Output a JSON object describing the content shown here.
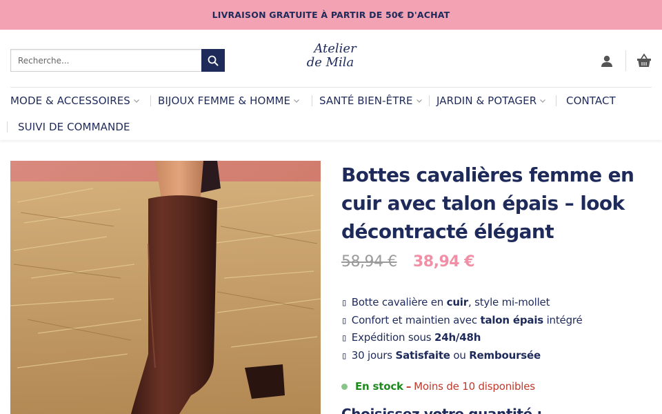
{
  "announcement": {
    "text": "LIVRAISON GRATUITE À PARTIR DE 50€ D'ACHAT"
  },
  "header": {
    "search": {
      "placeholder": "Recherche...",
      "value": ""
    },
    "logo": {
      "line1": "Atelier",
      "line2": "de Mila"
    },
    "icons": {
      "search": "search-icon",
      "account": "user-icon",
      "cart": "basket-icon"
    }
  },
  "nav": {
    "items": [
      {
        "label": "MODE & ACCESSOIRES",
        "has_dropdown": true
      },
      {
        "label": "BIJOUX FEMME & HOMME",
        "has_dropdown": true
      },
      {
        "label": "SANTÉ BIEN-ÊTRE",
        "has_dropdown": true
      },
      {
        "label": "JARDIN & POTAGER",
        "has_dropdown": true
      },
      {
        "label": "CONTACT",
        "has_dropdown": false
      },
      {
        "label": "SUIVI DE COMMANDE",
        "has_dropdown": false
      }
    ]
  },
  "product": {
    "title": "Bottes cavalières femme en cuir avec talon épais – look décontracté élégant",
    "price_old": "58,94 €",
    "price_new": "38,94 €",
    "features": [
      {
        "icon": "▯",
        "before": " Botte cavalière en ",
        "bold": "cuir",
        "after": ", style mi-mollet",
        "bold2": "",
        "after2": ""
      },
      {
        "icon": "▯",
        "before": " Confort et maintien avec ",
        "bold": "talon épais",
        "after": " intégré",
        "bold2": "",
        "after2": ""
      },
      {
        "icon": "▯",
        "before": " Expédition sous ",
        "bold": "24h/48h",
        "after": "",
        "bold2": "",
        "after2": ""
      },
      {
        "icon": "▯",
        "before": " 30 jours ",
        "bold": "Satisfaite",
        "after": " ou ",
        "bold2": "Remboursée",
        "after2": ""
      }
    ],
    "stock": {
      "status": "En stock",
      "dash": "–",
      "availability": "Moins de 10 disponibles"
    },
    "quantity_label": "Choisissez votre quantité :"
  },
  "colors": {
    "announcement_bg": "#f2a2b3",
    "brand_navy": "#1e2a5a",
    "sale_pink": "#f08fa5",
    "in_stock_green": "#1d8a1d",
    "availability_red": "#c0392b"
  }
}
